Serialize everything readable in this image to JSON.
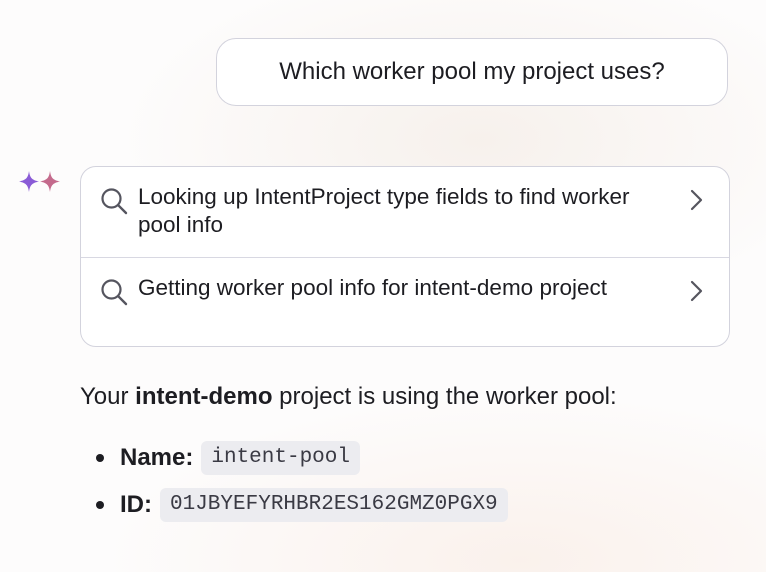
{
  "user_message": {
    "text": "Which worker pool my project uses?"
  },
  "assistant": {
    "avatar_icon": "sparkle-icon",
    "colors": {
      "sparkle_left": "#8a5bd6",
      "sparkle_right": "#c46a8c"
    },
    "tool_calls": [
      {
        "icon": "search-icon",
        "label": "Looking up IntentProject type fields to find worker pool info",
        "chevron": "chevron-right-icon"
      },
      {
        "icon": "search-icon",
        "label": "Getting worker pool info for intent-demo project",
        "chevron": "chevron-right-icon"
      }
    ],
    "answer": {
      "prefix": "Your ",
      "project_name": "intent-demo",
      "suffix": " project is using the worker pool:"
    },
    "details": [
      {
        "label": "Name:",
        "value": "intent-pool"
      },
      {
        "label": "ID:",
        "value": "01JBYEFYRHBR2ES162GMZ0PGX9"
      }
    ]
  }
}
